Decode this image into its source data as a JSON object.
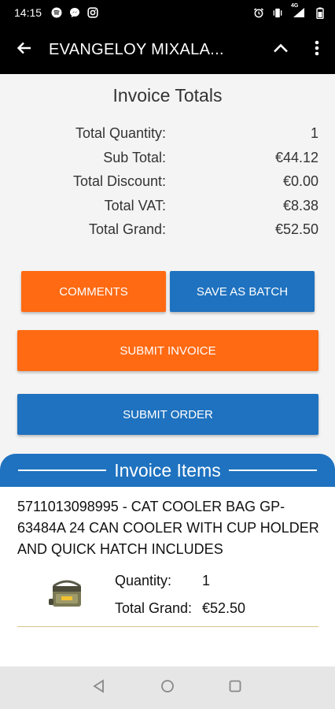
{
  "status_bar": {
    "time": "14:15",
    "left_icons": [
      "spotify-icon",
      "messenger-icon",
      "instagram-icon"
    ],
    "right_icons": [
      "alarm-icon",
      "vibrate-icon",
      "signal-4g-icon",
      "battery-icon"
    ],
    "network_label": "4G"
  },
  "app_bar": {
    "title": "EVANGELOY MIXALA...",
    "back_icon": "arrow-left-icon",
    "collapse_icon": "chevron-up-icon",
    "menu_icon": "more-vertical-icon"
  },
  "totals": {
    "title": "Invoice Totals",
    "rows": [
      {
        "label": "Total Quantity:",
        "value": "1"
      },
      {
        "label": "Sub Total:",
        "value": "€44.12"
      },
      {
        "label": "Total Discount:",
        "value": "€0.00"
      },
      {
        "label": "Total VAT:",
        "value": "€8.38"
      },
      {
        "label": "Total Grand:",
        "value": "€52.50"
      }
    ]
  },
  "buttons": {
    "comments": "COMMENTS",
    "save_batch": "SAVE AS BATCH",
    "submit_invoice": "SUBMIT INVOICE",
    "submit_order": "SUBMIT ORDER"
  },
  "items": {
    "header": "Invoice Items",
    "list": [
      {
        "description": "5711013098995 - CAT COOLER BAG GP-63484A 24 CAN COOLER WITH CUP HOLDER  AND QUICK HATCH INCLUDES",
        "quantity_label": "Quantity:",
        "quantity": "1",
        "grand_label": "Total Grand:",
        "grand": "€52.50"
      }
    ]
  },
  "nav": {
    "back": "nav-back-icon",
    "home": "nav-home-icon",
    "recents": "nav-recents-icon"
  },
  "colors": {
    "orange": "#ff6a13",
    "blue": "#1f72bf",
    "app_bar": "#000000",
    "background": "#f4f4f4"
  }
}
